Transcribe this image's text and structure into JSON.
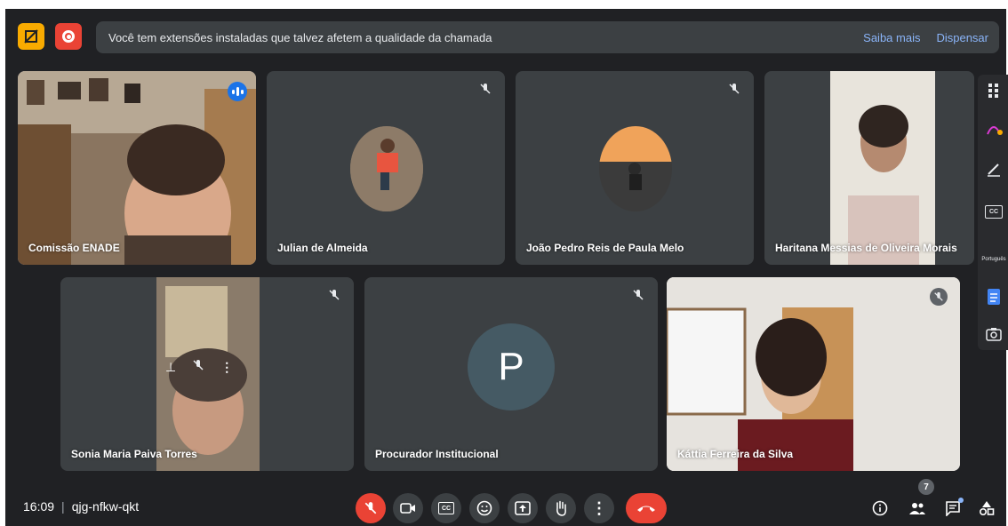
{
  "banner": {
    "message": "Você tem extensões instaladas que talvez afetem a qualidade da chamada",
    "learn_more": "Saiba mais",
    "dismiss": "Dispensar"
  },
  "participants": [
    {
      "name": "Comissão ENADE",
      "muted": false,
      "speaking": true
    },
    {
      "name": "Julian de Almeida",
      "muted": true
    },
    {
      "name": "João Pedro Reis de Paula Melo",
      "muted": true
    },
    {
      "name": "Haritana Messias de Oliveira Morais",
      "muted": false
    },
    {
      "name": "Sonia Maria Paiva Torres",
      "muted": true
    },
    {
      "name": "Procurador Institucional",
      "muted": true,
      "avatar_letter": "P",
      "avatar_color": "#455a64"
    },
    {
      "name": "Káttia Ferreira da Silva",
      "muted": true
    }
  ],
  "side_panel": {
    "language_label": "Português"
  },
  "bottom": {
    "time": "16:09",
    "meeting_code": "qjg-nfkw-qkt",
    "participant_count": "7"
  },
  "colors": {
    "background": "#202124",
    "tile": "#3c4043",
    "accent": "#8ab4f8",
    "danger": "#ea4335"
  }
}
